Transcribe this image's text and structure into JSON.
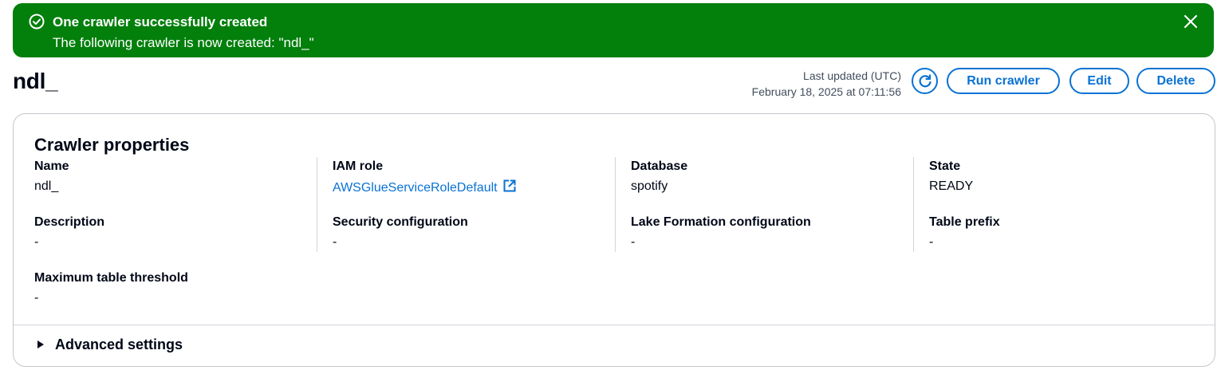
{
  "flash": {
    "title": "One crawler successfully created",
    "message": "The following crawler is now created: \"ndl_\""
  },
  "header": {
    "title": "ndl_",
    "last_updated_label": "Last updated (UTC)",
    "last_updated_value": "February 18, 2025 at 07:11:56",
    "run_label": "Run crawler",
    "edit_label": "Edit",
    "delete_label": "Delete"
  },
  "properties": {
    "title": "Crawler properties",
    "name": {
      "label": "Name",
      "value": "ndl_"
    },
    "iam_role": {
      "label": "IAM role",
      "value": "AWSGlueServiceRoleDefault"
    },
    "database": {
      "label": "Database",
      "value": "spotify"
    },
    "state": {
      "label": "State",
      "value": "READY"
    },
    "description": {
      "label": "Description",
      "value": "-"
    },
    "security_configuration": {
      "label": "Security configuration",
      "value": "-"
    },
    "lake_formation": {
      "label": "Lake Formation configuration",
      "value": "-"
    },
    "table_prefix": {
      "label": "Table prefix",
      "value": "-"
    },
    "max_table_threshold": {
      "label": "Maximum table threshold",
      "value": "-"
    }
  },
  "advanced": {
    "label": "Advanced settings"
  },
  "colors": {
    "success": "#037f0c",
    "link": "#0972d3",
    "text": "#000716"
  },
  "icons": {
    "flash": "check-circle-icon",
    "close": "close-icon",
    "refresh": "refresh-icon",
    "external": "external-link-icon",
    "caret": "caret-right-icon"
  }
}
